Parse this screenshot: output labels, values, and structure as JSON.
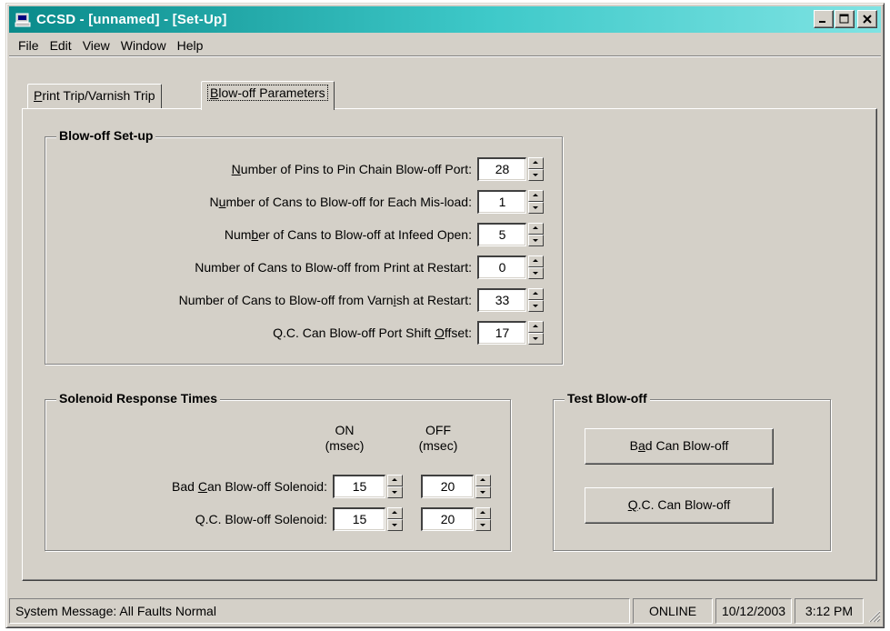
{
  "window": {
    "title": "CCSD - [unnamed] - [Set-Up]"
  },
  "menu": [
    "File",
    "Edit",
    "View",
    "Window",
    "Help"
  ],
  "tabs": [
    {
      "label": "Print Trip/Varnish Trip",
      "active": false
    },
    {
      "label": "Blow-off Parameters",
      "active": true
    }
  ],
  "blowoff_setup": {
    "title": "Blow-off Set-up",
    "rows": [
      {
        "label_pre": "",
        "label_u": "N",
        "label_post": "umber of Pins to Pin Chain Blow-off Port:",
        "value": "28"
      },
      {
        "label_pre": "N",
        "label_u": "u",
        "label_post": "mber of Cans to Blow-off for Each Mis-load:",
        "value": "1"
      },
      {
        "label_pre": "Num",
        "label_u": "b",
        "label_post": "er of Cans to Blow-off at Infeed Open:",
        "value": "5"
      },
      {
        "label_pre": "Number of Cans to Blow-off from Print at Restart:",
        "label_u": "",
        "label_post": "",
        "value": "0"
      },
      {
        "label_pre": "Number of Cans to Blow-off from Varn",
        "label_u": "i",
        "label_post": "sh at Restart:",
        "value": "33"
      },
      {
        "label_pre": "Q.C. Can Blow-off Port Shift ",
        "label_u": "O",
        "label_post": "ffset:",
        "value": "17"
      }
    ]
  },
  "solenoid": {
    "title": "Solenoid Response Times",
    "col_on": "ON",
    "col_on_unit": "(msec)",
    "col_off": "OFF",
    "col_off_unit": "(msec)",
    "rows": [
      {
        "label_pre": "Bad ",
        "label_u": "C",
        "label_post": "an Blow-off Solenoid:",
        "on": "15",
        "off": "20"
      },
      {
        "label_pre": "Q.C. Blow-off Solenoid:",
        "label_u": "",
        "label_post": "",
        "on": "15",
        "off": "20"
      }
    ]
  },
  "test_blowoff": {
    "title": "Test Blow-off",
    "buttons": [
      {
        "pre": "B",
        "u": "a",
        "post": "d Can Blow-off"
      },
      {
        "pre": "",
        "u": "Q",
        "post": ".C. Can Blow-off"
      }
    ]
  },
  "status": {
    "message": "System Message:  All Faults Normal",
    "online": "ONLINE",
    "date": "10/12/2003",
    "time": "3:12 PM"
  }
}
